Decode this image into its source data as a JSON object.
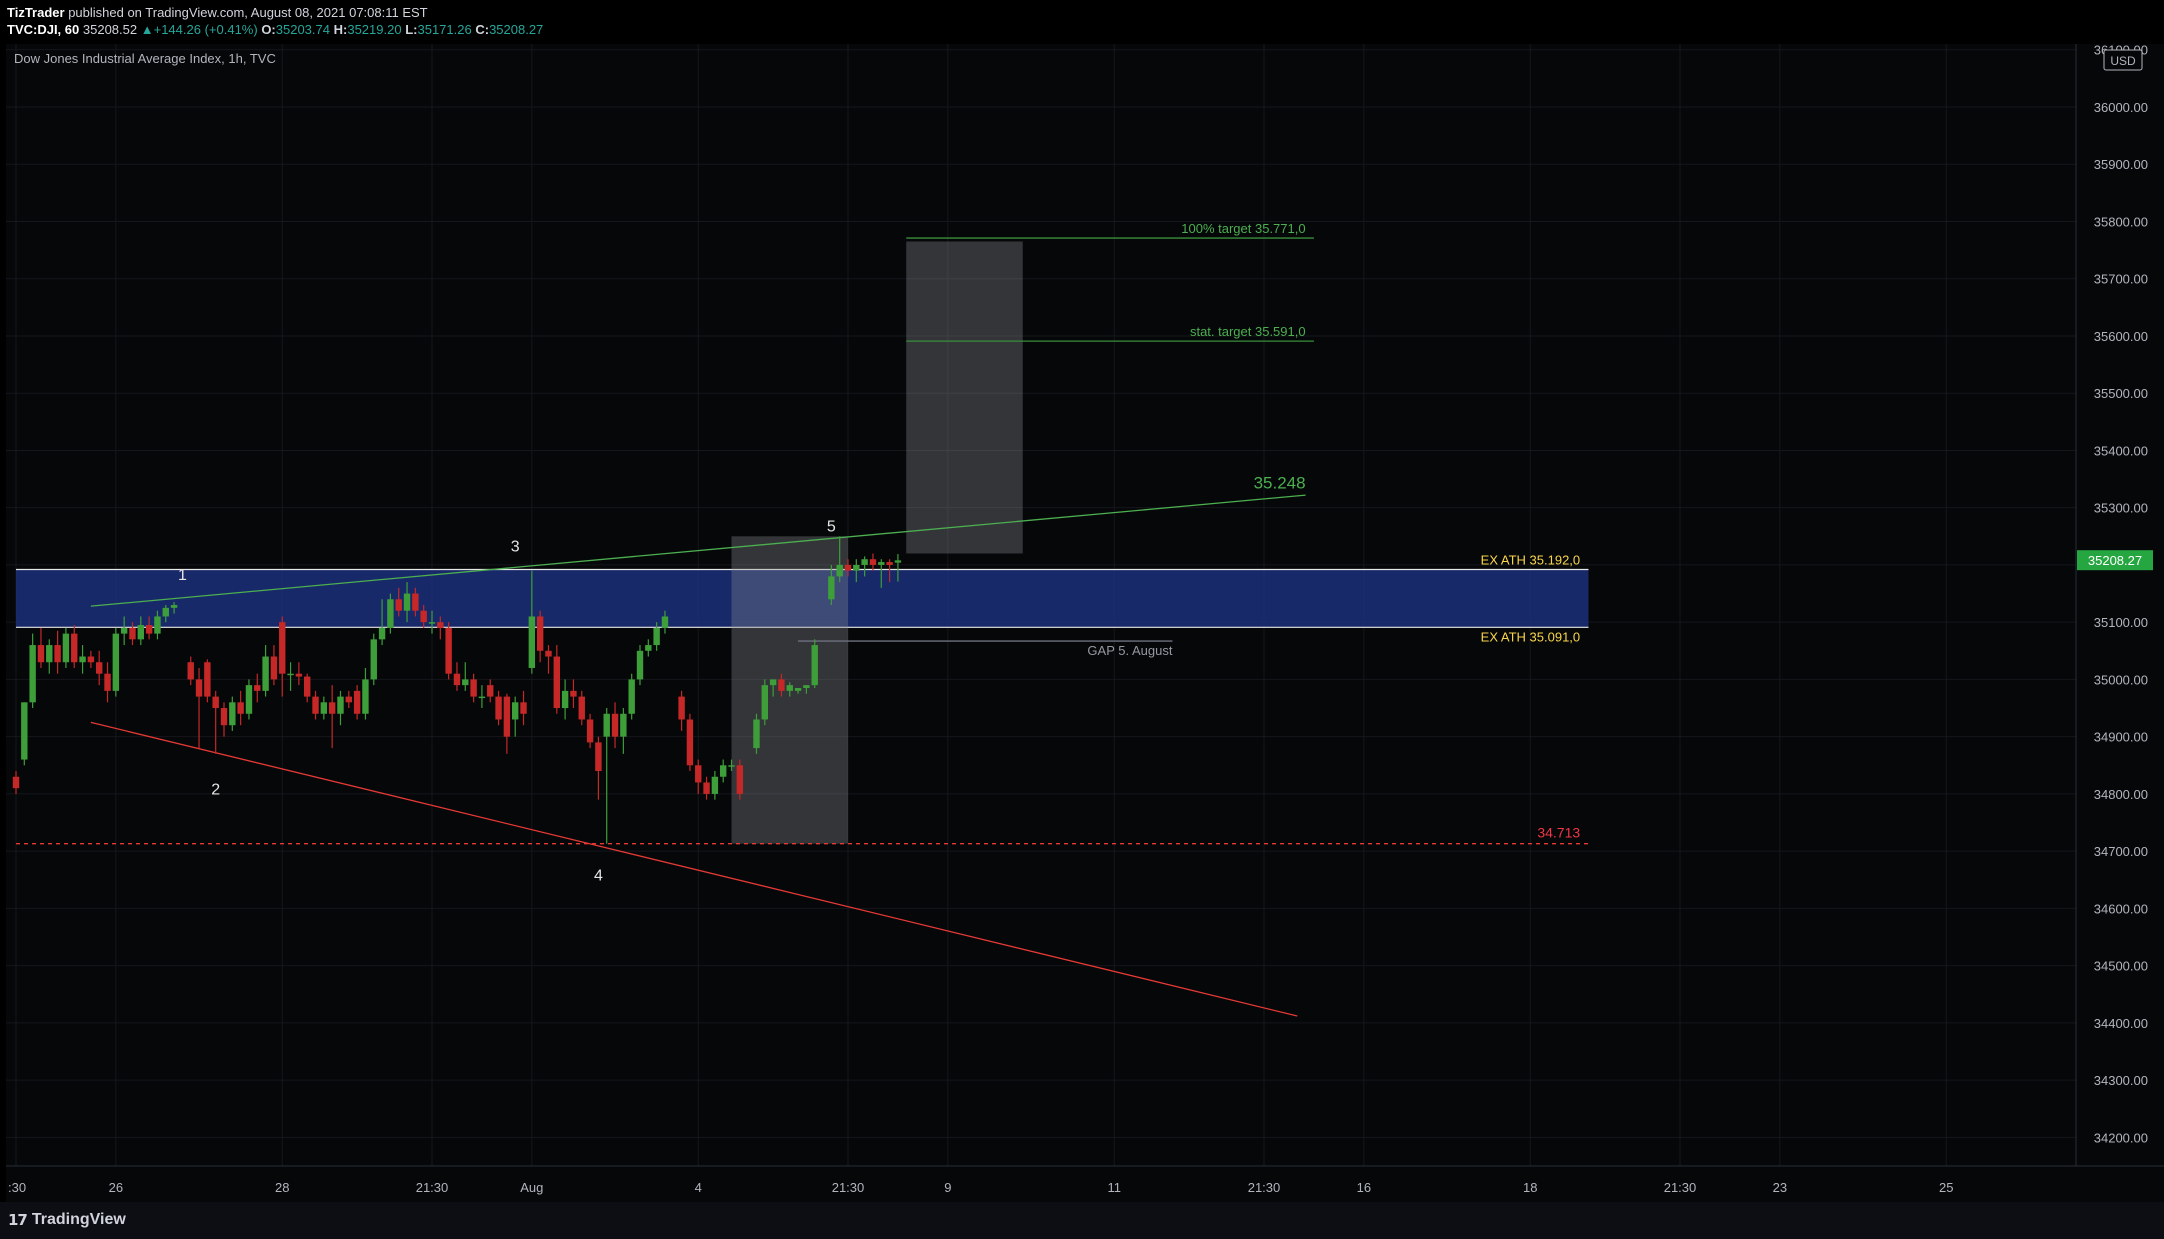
{
  "header": {
    "author": "TizTrader",
    "published_text": "published on TradingView.com, August 08, 2021 07:08:11 EST",
    "symbol_interval": "TVC:DJI, 60",
    "last_price": "35208.52",
    "change_arrow": "▲",
    "change": "+144.26 (+0.41%)",
    "o_label": "O:",
    "o_value": "35203.74",
    "h_label": "H:",
    "h_value": "35219.20",
    "l_label": "L:",
    "l_value": "35171.26",
    "c_label": "C:",
    "c_value": "35208.27"
  },
  "footer": {
    "brand": "TradingView",
    "logo_icon": "tradingview-logo-icon"
  },
  "chart_data": {
    "type": "candlestick",
    "title": "Dow Jones Industrial Average Index, 1h, TVC",
    "currency": "USD",
    "ylim": [
      34150,
      36110
    ],
    "yticks": [
      36100,
      36000,
      35900,
      35800,
      35700,
      35600,
      35500,
      35400,
      35300,
      35200,
      35100,
      35000,
      34900,
      34800,
      34700,
      34600,
      34500,
      34400,
      34300,
      34200
    ],
    "ytick_labels": [
      "36100.00",
      "36000.00",
      "35900.00",
      "35800.00",
      "35700.00",
      "35600.00",
      "35500.00",
      "35400.00",
      "35300.00",
      "35200.00",
      "35100.00",
      "35000.00",
      "34900.00",
      "34800.00",
      "34700.00",
      "34600.00",
      "34500.00",
      "34400.00",
      "34300.00",
      "34200.00"
    ],
    "xlim": [
      0,
      249
    ],
    "xticks": [
      {
        "i": 0,
        "label": ":30"
      },
      {
        "i": 12,
        "label": "26"
      },
      {
        "i": 32,
        "label": "28"
      },
      {
        "i": 50,
        "label": "21:30"
      },
      {
        "i": 62,
        "label": "Aug"
      },
      {
        "i": 82,
        "label": "4"
      },
      {
        "i": 100,
        "label": "21:30"
      },
      {
        "i": 112,
        "label": "9"
      },
      {
        "i": 132,
        "label": "11"
      },
      {
        "i": 150,
        "label": "21:30"
      },
      {
        "i": 162,
        "label": "16"
      },
      {
        "i": 182,
        "label": "18"
      },
      {
        "i": 200,
        "label": "21:30"
      },
      {
        "i": 212,
        "label": "23"
      },
      {
        "i": 232,
        "label": "25"
      }
    ],
    "colors": {
      "up": "#26a69a",
      "up_fill": "#3e9e3a",
      "down": "#c62828",
      "text": "#b2b5be",
      "green": "#4caf50",
      "red": "#f23645",
      "yellow": "#f9d64a",
      "zone": "#1c2f7a"
    },
    "candles": [
      {
        "i": 0,
        "o": 34830,
        "h": 34840,
        "l": 34800,
        "c": 34810
      },
      {
        "i": 1,
        "o": 34860,
        "h": 34960,
        "l": 34850,
        "c": 34960
      },
      {
        "i": 2,
        "o": 34960,
        "h": 35080,
        "l": 34950,
        "c": 35060
      },
      {
        "i": 3,
        "o": 35060,
        "h": 35090,
        "l": 35020,
        "c": 35030
      },
      {
        "i": 4,
        "o": 35030,
        "h": 35070,
        "l": 35010,
        "c": 35060
      },
      {
        "i": 5,
        "o": 35060,
        "h": 35085,
        "l": 35010,
        "c": 35030
      },
      {
        "i": 6,
        "o": 35030,
        "h": 35090,
        "l": 35020,
        "c": 35080
      },
      {
        "i": 7,
        "o": 35080,
        "h": 35095,
        "l": 35020,
        "c": 35030
      },
      {
        "i": 8,
        "o": 35030,
        "h": 35060,
        "l": 35010,
        "c": 35040
      },
      {
        "i": 9,
        "o": 35040,
        "h": 35050,
        "l": 35020,
        "c": 35030
      },
      {
        "i": 10,
        "o": 35030,
        "h": 35050,
        "l": 34990,
        "c": 35010
      },
      {
        "i": 11,
        "o": 35010,
        "h": 35030,
        "l": 34960,
        "c": 34980
      },
      {
        "i": 12,
        "o": 34980,
        "h": 35090,
        "l": 34970,
        "c": 35080
      },
      {
        "i": 13,
        "o": 35080,
        "h": 35110,
        "l": 35060,
        "c": 35090
      },
      {
        "i": 14,
        "o": 35090,
        "h": 35100,
        "l": 35060,
        "c": 35070
      },
      {
        "i": 15,
        "o": 35070,
        "h": 35110,
        "l": 35060,
        "c": 35095
      },
      {
        "i": 16,
        "o": 35095,
        "h": 35110,
        "l": 35070,
        "c": 35080
      },
      {
        "i": 17,
        "o": 35080,
        "h": 35120,
        "l": 35070,
        "c": 35110
      },
      {
        "i": 18,
        "o": 35110,
        "h": 35130,
        "l": 35100,
        "c": 35125
      },
      {
        "i": 19,
        "o": 35125,
        "h": 35135,
        "l": 35115,
        "c": 35130
      },
      {
        "i": 21,
        "o": 35030,
        "h": 35040,
        "l": 34990,
        "c": 35000
      },
      {
        "i": 22,
        "o": 35000,
        "h": 35020,
        "l": 34880,
        "c": 34970
      },
      {
        "i": 23,
        "o": 35030,
        "h": 35035,
        "l": 34960,
        "c": 34970
      },
      {
        "i": 24,
        "o": 34970,
        "h": 34980,
        "l": 34870,
        "c": 34950
      },
      {
        "i": 25,
        "o": 34950,
        "h": 34960,
        "l": 34900,
        "c": 34920
      },
      {
        "i": 26,
        "o": 34920,
        "h": 34970,
        "l": 34910,
        "c": 34960
      },
      {
        "i": 27,
        "o": 34960,
        "h": 34980,
        "l": 34920,
        "c": 34940
      },
      {
        "i": 28,
        "o": 34940,
        "h": 35000,
        "l": 34930,
        "c": 34990
      },
      {
        "i": 29,
        "o": 34990,
        "h": 35010,
        "l": 34960,
        "c": 34980
      },
      {
        "i": 30,
        "o": 34980,
        "h": 35060,
        "l": 34970,
        "c": 35040
      },
      {
        "i": 31,
        "o": 35040,
        "h": 35060,
        "l": 34990,
        "c": 35000
      },
      {
        "i": 32,
        "o": 35100,
        "h": 35110,
        "l": 34970,
        "c": 35010
      },
      {
        "i": 33,
        "o": 35010,
        "h": 35030,
        "l": 34980,
        "c": 35010
      },
      {
        "i": 34,
        "o": 35010,
        "h": 35030,
        "l": 34990,
        "c": 35005
      },
      {
        "i": 35,
        "o": 35005,
        "h": 35010,
        "l": 34960,
        "c": 34970
      },
      {
        "i": 36,
        "o": 34970,
        "h": 34980,
        "l": 34930,
        "c": 34940
      },
      {
        "i": 37,
        "o": 34940,
        "h": 34970,
        "l": 34930,
        "c": 34960
      },
      {
        "i": 38,
        "o": 34960,
        "h": 34990,
        "l": 34880,
        "c": 34940
      },
      {
        "i": 39,
        "o": 34940,
        "h": 34980,
        "l": 34920,
        "c": 34970
      },
      {
        "i": 40,
        "o": 34970,
        "h": 34980,
        "l": 34950,
        "c": 34960
      },
      {
        "i": 41,
        "o": 34980,
        "h": 34990,
        "l": 34930,
        "c": 34940
      },
      {
        "i": 42,
        "o": 34940,
        "h": 35020,
        "l": 34930,
        "c": 35000
      },
      {
        "i": 43,
        "o": 35000,
        "h": 35080,
        "l": 34990,
        "c": 35070
      },
      {
        "i": 44,
        "o": 35070,
        "h": 35140,
        "l": 35060,
        "c": 35090
      },
      {
        "i": 45,
        "o": 35090,
        "h": 35150,
        "l": 35080,
        "c": 35140
      },
      {
        "i": 46,
        "o": 35140,
        "h": 35160,
        "l": 35110,
        "c": 35120
      },
      {
        "i": 47,
        "o": 35120,
        "h": 35170,
        "l": 35100,
        "c": 35150
      },
      {
        "i": 48,
        "o": 35150,
        "h": 35160,
        "l": 35110,
        "c": 35120
      },
      {
        "i": 49,
        "o": 35120,
        "h": 35130,
        "l": 35090,
        "c": 35100
      },
      {
        "i": 50,
        "o": 35100,
        "h": 35120,
        "l": 35080,
        "c": 35100
      },
      {
        "i": 51,
        "o": 35100,
        "h": 35110,
        "l": 35070,
        "c": 35090
      },
      {
        "i": 52,
        "o": 35090,
        "h": 35100,
        "l": 35000,
        "c": 35010
      },
      {
        "i": 53,
        "o": 35010,
        "h": 35030,
        "l": 34980,
        "c": 34990
      },
      {
        "i": 54,
        "o": 34990,
        "h": 35030,
        "l": 34980,
        "c": 35000
      },
      {
        "i": 55,
        "o": 35000,
        "h": 35010,
        "l": 34960,
        "c": 34970
      },
      {
        "i": 56,
        "o": 34970,
        "h": 34990,
        "l": 34950,
        "c": 34970
      },
      {
        "i": 57,
        "o": 34990,
        "h": 35000,
        "l": 34960,
        "c": 34970
      },
      {
        "i": 58,
        "o": 34970,
        "h": 34980,
        "l": 34920,
        "c": 34930
      },
      {
        "i": 59,
        "o": 34970,
        "h": 34975,
        "l": 34870,
        "c": 34900
      },
      {
        "i": 60,
        "o": 34930,
        "h": 34970,
        "l": 34900,
        "c": 34960
      },
      {
        "i": 61,
        "o": 34960,
        "h": 34980,
        "l": 34920,
        "c": 34940
      },
      {
        "i": 62,
        "o": 35020,
        "h": 35190,
        "l": 35010,
        "c": 35110
      },
      {
        "i": 63,
        "o": 35110,
        "h": 35120,
        "l": 35030,
        "c": 35050
      },
      {
        "i": 64,
        "o": 35050,
        "h": 35060,
        "l": 35010,
        "c": 35040
      },
      {
        "i": 65,
        "o": 35040,
        "h": 35060,
        "l": 34940,
        "c": 34950
      },
      {
        "i": 66,
        "o": 34950,
        "h": 35000,
        "l": 34930,
        "c": 34980
      },
      {
        "i": 67,
        "o": 34980,
        "h": 35000,
        "l": 34950,
        "c": 34970
      },
      {
        "i": 68,
        "o": 34970,
        "h": 34980,
        "l": 34920,
        "c": 34930
      },
      {
        "i": 69,
        "o": 34930,
        "h": 34940,
        "l": 34880,
        "c": 34890
      },
      {
        "i": 70,
        "o": 34890,
        "h": 34900,
        "l": 34790,
        "c": 34840
      },
      {
        "i": 71,
        "o": 34900,
        "h": 34950,
        "l": 34713,
        "c": 34940
      },
      {
        "i": 72,
        "o": 34940,
        "h": 34960,
        "l": 34880,
        "c": 34900
      },
      {
        "i": 73,
        "o": 34900,
        "h": 34950,
        "l": 34870,
        "c": 34940
      },
      {
        "i": 74,
        "o": 34940,
        "h": 35010,
        "l": 34930,
        "c": 35000
      },
      {
        "i": 75,
        "o": 35000,
        "h": 35060,
        "l": 34990,
        "c": 35050
      },
      {
        "i": 76,
        "o": 35050,
        "h": 35070,
        "l": 35040,
        "c": 35060
      },
      {
        "i": 77,
        "o": 35060,
        "h": 35100,
        "l": 35050,
        "c": 35090
      },
      {
        "i": 78,
        "o": 35090,
        "h": 35120,
        "l": 35080,
        "c": 35110
      },
      {
        "i": 80,
        "o": 34970,
        "h": 34980,
        "l": 34910,
        "c": 34930
      },
      {
        "i": 81,
        "o": 34930,
        "h": 34940,
        "l": 34840,
        "c": 34850
      },
      {
        "i": 82,
        "o": 34850,
        "h": 34860,
        "l": 34800,
        "c": 34820
      },
      {
        "i": 83,
        "o": 34820,
        "h": 34830,
        "l": 34790,
        "c": 34800
      },
      {
        "i": 84,
        "o": 34800,
        "h": 34840,
        "l": 34790,
        "c": 34830
      },
      {
        "i": 85,
        "o": 34830,
        "h": 34860,
        "l": 34820,
        "c": 34850
      },
      {
        "i": 86,
        "o": 34850,
        "h": 34860,
        "l": 34840,
        "c": 34850
      },
      {
        "i": 87,
        "o": 34850,
        "h": 34860,
        "l": 34790,
        "c": 34800
      },
      {
        "i": 89,
        "o": 34880,
        "h": 34940,
        "l": 34870,
        "c": 34930
      },
      {
        "i": 90,
        "o": 34930,
        "h": 35000,
        "l": 34920,
        "c": 34990
      },
      {
        "i": 91,
        "o": 34990,
        "h": 35000,
        "l": 34970,
        "c": 35000
      },
      {
        "i": 92,
        "o": 35000,
        "h": 35010,
        "l": 34970,
        "c": 34980
      },
      {
        "i": 93,
        "o": 34980,
        "h": 34995,
        "l": 34970,
        "c": 34990
      },
      {
        "i": 94,
        "o": 34980,
        "h": 34985,
        "l": 34975,
        "c": 34985
      },
      {
        "i": 95,
        "o": 34985,
        "h": 34990,
        "l": 34975,
        "c": 34990
      },
      {
        "i": 96,
        "o": 34990,
        "h": 35070,
        "l": 34985,
        "c": 35060
      },
      {
        "i": 98,
        "o": 35140,
        "h": 35200,
        "l": 35130,
        "c": 35180
      },
      {
        "i": 99,
        "o": 35180,
        "h": 35250,
        "l": 35170,
        "c": 35200
      },
      {
        "i": 100,
        "o": 35200,
        "h": 35210,
        "l": 35180,
        "c": 35190
      },
      {
        "i": 101,
        "o": 35190,
        "h": 35210,
        "l": 35170,
        "c": 35200
      },
      {
        "i": 102,
        "o": 35200,
        "h": 35215,
        "l": 35180,
        "c": 35210
      },
      {
        "i": 103,
        "o": 35210,
        "h": 35220,
        "l": 35190,
        "c": 35200
      },
      {
        "i": 104,
        "o": 35200,
        "h": 35210,
        "l": 35160,
        "c": 35205
      },
      {
        "i": 105,
        "o": 35205,
        "h": 35210,
        "l": 35170,
        "c": 35200
      },
      {
        "i": 106,
        "o": 35204,
        "h": 35219,
        "l": 35171,
        "c": 35208
      }
    ],
    "zones": [
      {
        "name": "ath-zone",
        "x0": 0,
        "x1": 189,
        "y0": 35091,
        "y1": 35192
      },
      {
        "name": "gray-box-left",
        "x0": 86,
        "x1": 100,
        "y0": 34713,
        "y1": 35250
      },
      {
        "name": "gray-box-right",
        "x0": 107,
        "x1": 121,
        "y0": 35220,
        "y1": 35765
      }
    ],
    "lines": [
      {
        "name": "upper-trendline",
        "x0": 9,
        "y0": 35128,
        "x1": 155,
        "y1": 35322,
        "color": "#4caf50"
      },
      {
        "name": "lower-trendline",
        "x0": 9,
        "y0": 34925,
        "x1": 154,
        "y1": 34412,
        "color": "#e53935"
      },
      {
        "name": "target-100-line",
        "x0": 107,
        "y0": 35771,
        "x1": 156,
        "y1": 35771,
        "color": "#388e3c"
      },
      {
        "name": "stat-target-line",
        "x0": 107,
        "y0": 35591,
        "x1": 156,
        "y1": 35591,
        "color": "#388e3c"
      },
      {
        "name": "gap-line",
        "x0": 94,
        "y0": 35067,
        "x1": 139,
        "y1": 35067,
        "color": "#6e7280"
      }
    ],
    "support_line": {
      "value": 34713,
      "x0": 0,
      "x1": 189,
      "label": "34.713"
    },
    "annotations": [
      {
        "text": "100% target 35.771,0",
        "i": 155,
        "v": 35771,
        "anchor": "end",
        "color": "green"
      },
      {
        "text": "stat. target 35.591,0",
        "i": 155,
        "v": 35591,
        "anchor": "end",
        "color": "green"
      },
      {
        "text": "35.248",
        "i": 155,
        "v": 35325,
        "anchor": "end",
        "color": "green"
      },
      {
        "text": "EX ATH 35.192,0",
        "i": 188,
        "v": 35192,
        "anchor": "end",
        "color": "yellow"
      },
      {
        "text": "EX ATH 35.091,0",
        "i": 188,
        "v": 35091,
        "anchor": "end",
        "color": "yellow"
      },
      {
        "text": "GAP 5. August",
        "i": 139,
        "v": 35067,
        "anchor": "end",
        "color": "gray"
      },
      {
        "text": "1",
        "i": 20,
        "v": 35165,
        "anchor": "middle",
        "color": "white"
      },
      {
        "text": "2",
        "i": 24,
        "v": 34790,
        "anchor": "middle",
        "color": "white"
      },
      {
        "text": "3",
        "i": 60,
        "v": 35215,
        "anchor": "middle",
        "color": "white"
      },
      {
        "text": "4",
        "i": 70,
        "v": 34640,
        "anchor": "middle",
        "color": "white"
      },
      {
        "text": "5",
        "i": 98,
        "v": 35250,
        "anchor": "middle",
        "color": "white"
      }
    ],
    "last_price_tag": {
      "value": 35208.27,
      "label": "35208.27"
    }
  }
}
